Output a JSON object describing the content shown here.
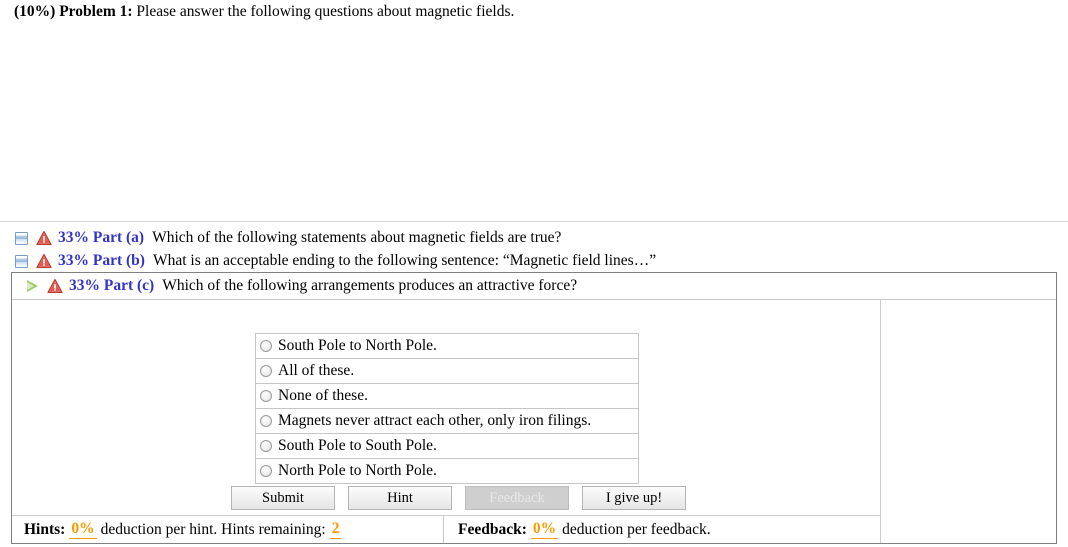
{
  "problem": {
    "weight": "(10%)",
    "number": "Problem 1:",
    "prompt": "Please answer the following questions about magnetic fields."
  },
  "parts": [
    {
      "state_icon": "collapsed-window-icon",
      "alert_icon": "warning-triangle-icon",
      "label": "33% Part (a)",
      "text": "Which of the following statements about magnetic fields are true?"
    },
    {
      "state_icon": "collapsed-window-icon",
      "alert_icon": "warning-triangle-icon",
      "label": "33% Part (b)",
      "text": "What is an acceptable ending to the following sentence: “Magnetic field lines…”"
    }
  ],
  "active_part": {
    "state_icon": "green-play-triangle-icon",
    "alert_icon": "warning-triangle-icon",
    "label": "33% Part (c)",
    "text": "Which of the following arrangements produces an attractive force?",
    "options": [
      {
        "label": "South Pole to North Pole.",
        "selected": false
      },
      {
        "label": "All of these.",
        "selected": false
      },
      {
        "label": "None of these.",
        "selected": false
      },
      {
        "label": "Magnets never attract each other, only iron filings.",
        "selected": false
      },
      {
        "label": "South Pole to South Pole.",
        "selected": false
      },
      {
        "label": "North Pole to North Pole.",
        "selected": false
      }
    ],
    "buttons": [
      {
        "label": "Submit",
        "disabled": false
      },
      {
        "label": "Hint",
        "disabled": false
      },
      {
        "label": "Feedback",
        "disabled": true
      },
      {
        "label": "I give up!",
        "disabled": false
      }
    ],
    "footer": {
      "hints_label": "Hints:",
      "hints_deduction": "0%",
      "hints_text": "deduction per hint. Hints remaining:",
      "hints_remaining": "2",
      "feedback_label": "Feedback:",
      "feedback_deduction": "0%",
      "feedback_text": "deduction per feedback."
    }
  },
  "colors": {
    "part_label": "#3333cc",
    "deduction": "#ff9900",
    "warning": "#d93025",
    "play": "#9ccd63"
  }
}
